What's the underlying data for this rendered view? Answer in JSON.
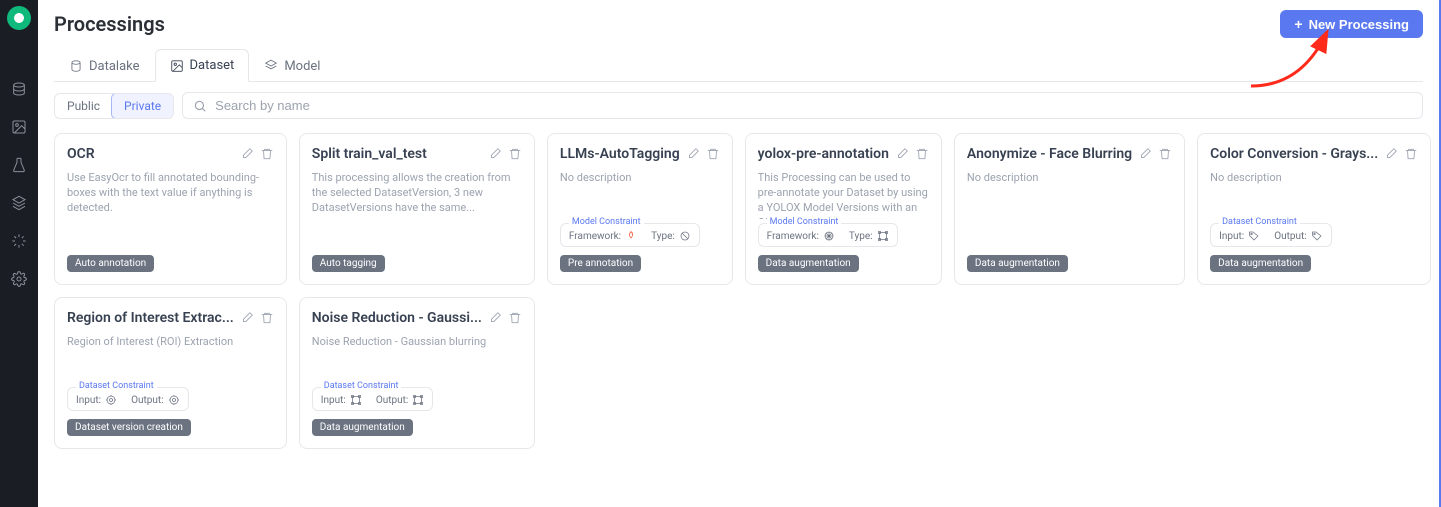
{
  "page": {
    "title": "Processings"
  },
  "new_button": {
    "label": "New Processing"
  },
  "tabs": [
    {
      "label": "Datalake",
      "active": false
    },
    {
      "label": "Dataset",
      "active": true
    },
    {
      "label": "Model",
      "active": false
    }
  ],
  "filter": {
    "public": "Public",
    "private": "Private",
    "active": "private"
  },
  "search": {
    "placeholder": "Search by name"
  },
  "constraint_labels": {
    "model": "Model Constraint",
    "dataset": "Dataset Constraint",
    "framework": "Framework:",
    "type": "Type:",
    "input": "Input:",
    "output": "Output:"
  },
  "cards": [
    {
      "title": "OCR",
      "desc": "Use EasyOcr to fill annotated bounding-boxes with the text value if anything is detected.",
      "tag": "Auto annotation",
      "constraint": null
    },
    {
      "title": "Split train_val_test",
      "desc": "This processing allows the creation from the selected DatasetVersion, 3 new DatasetVersions have the same...",
      "tag": "Auto tagging",
      "constraint": null
    },
    {
      "title": "LLMs-AutoTagging",
      "desc": "No description",
      "tag": "Pre annotation",
      "constraint": {
        "kind": "model",
        "a_key": "framework",
        "a_icon": "pytorch",
        "b_key": "type",
        "b_icon": "none"
      }
    },
    {
      "title": "yolox-pre-annotation",
      "desc": "This Processing can be used to pre-annotate your Dataset by using a YOLOX Model Versions with an ONNX...",
      "tag": "Data augmentation",
      "constraint": {
        "kind": "model",
        "a_key": "framework",
        "a_icon": "onnx",
        "b_key": "type",
        "b_icon": "bbox"
      }
    },
    {
      "title": "Anonymize - Face Blurring",
      "desc": "No description",
      "tag": "Data augmentation",
      "constraint": null
    },
    {
      "title": "Color Conversion - Grays...",
      "desc": "No description",
      "tag": "Data augmentation",
      "constraint": {
        "kind": "dataset",
        "a_key": "input",
        "a_icon": "tag",
        "b_key": "output",
        "b_icon": "tag"
      }
    },
    {
      "title": "Region of Interest Extrac...",
      "desc": "Region of Interest (ROI) Extraction",
      "tag": "Dataset version creation",
      "constraint": {
        "kind": "dataset",
        "a_key": "input",
        "a_icon": "target",
        "b_key": "output",
        "b_icon": "target"
      }
    },
    {
      "title": "Noise Reduction - Gaussi...",
      "desc": "Noise Reduction - Gaussian blurring",
      "tag": "Data augmentation",
      "constraint": {
        "kind": "dataset",
        "a_key": "input",
        "a_icon": "bbox",
        "b_key": "output",
        "b_icon": "bbox"
      }
    }
  ]
}
